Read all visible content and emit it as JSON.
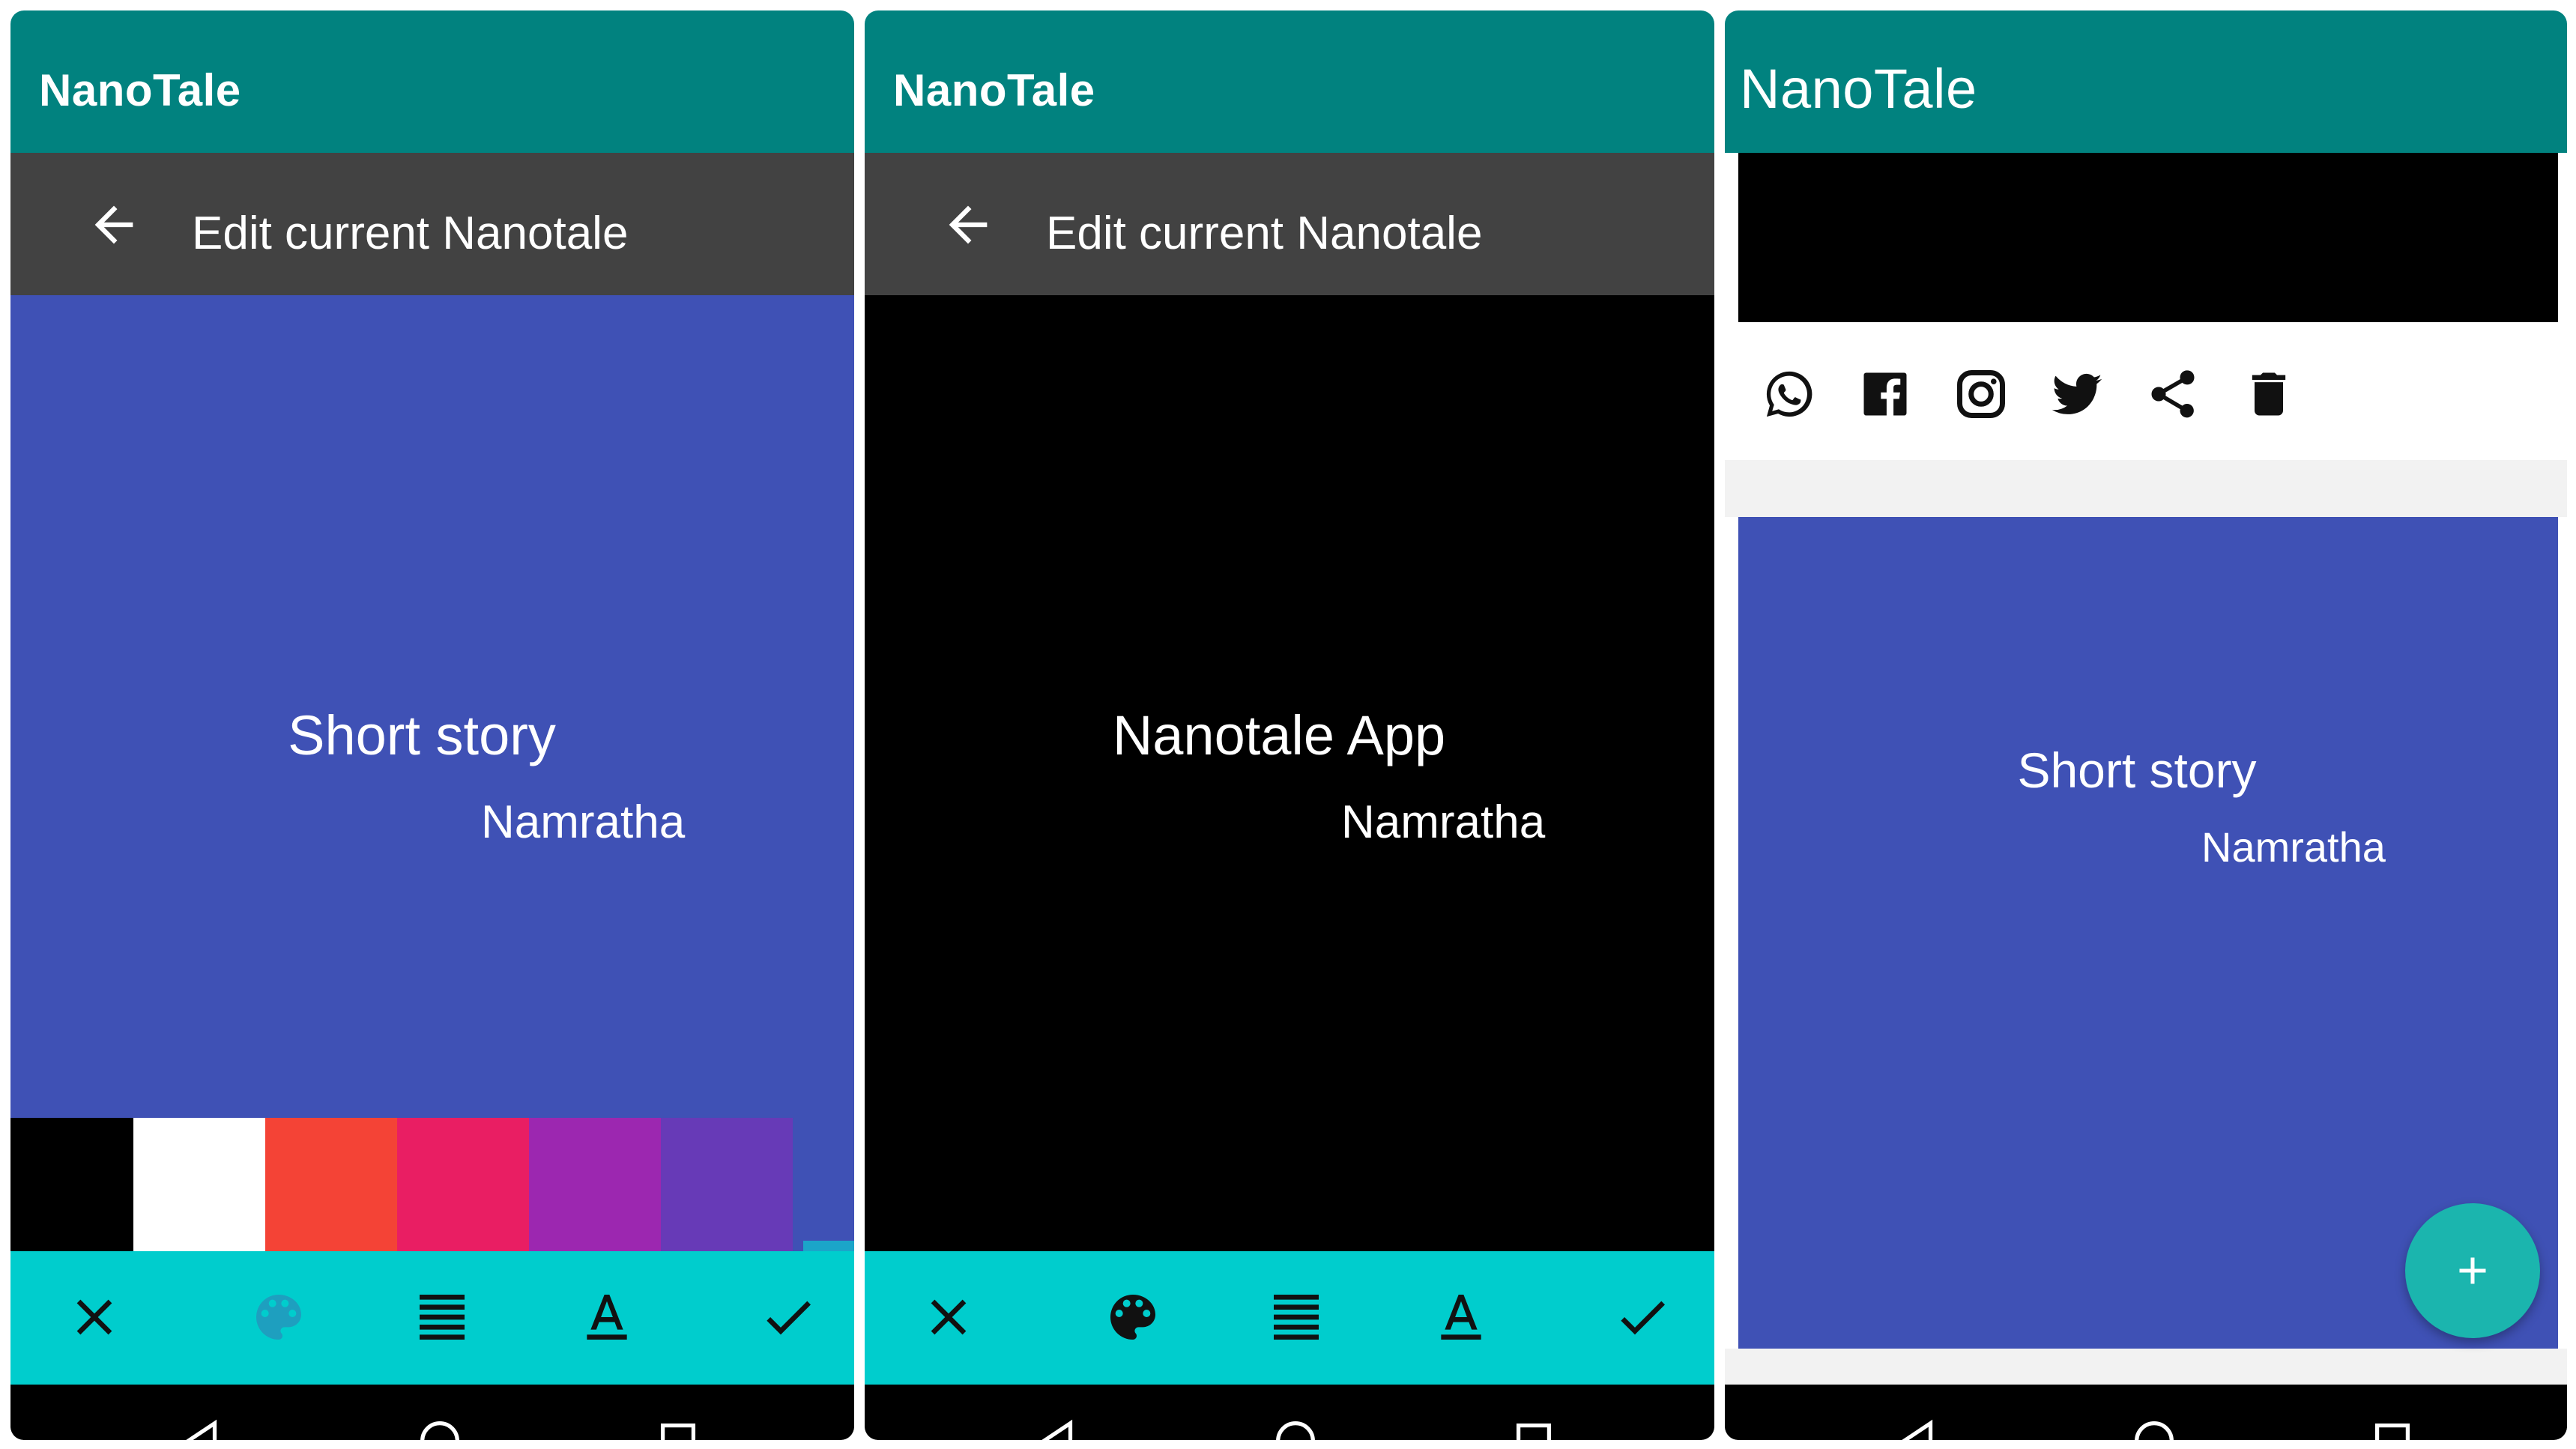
{
  "panels": [
    {
      "app_title": "NanoTale",
      "edit_title": "Edit current Nanotale",
      "story_title": "Short story",
      "story_author": "Namratha",
      "background_color": "#3f51b5",
      "swatch_colors": [
        "#000000",
        "#ffffff",
        "#f44336",
        "#e91e63",
        "#9c27b0",
        "#673ab7"
      ],
      "toolbar": [
        "close-icon",
        "palette-icon",
        "align-icon",
        "text-color-icon",
        "check-icon"
      ]
    },
    {
      "app_title": "NanoTale",
      "edit_title": "Edit current Nanotale",
      "story_title": "Nanotale App",
      "story_author": "Namratha",
      "background_color": "#000000",
      "toolbar": [
        "close-icon",
        "palette-icon",
        "align-icon",
        "text-color-icon",
        "check-icon"
      ]
    },
    {
      "app_title": "NanoTale",
      "share_icons": [
        "whatsapp-icon",
        "facebook-icon",
        "instagram-icon",
        "twitter-icon",
        "share-icon",
        "delete-icon"
      ],
      "story_title": "Short story",
      "story_author": "Namratha",
      "card_color": "#3f51b5",
      "fab": "add-icon"
    }
  ],
  "colors": {
    "appbar": "#01827f",
    "editbar": "#424242",
    "toolbar": "#00cdcd",
    "fab": "#1bb5ae"
  },
  "navigation": [
    "back-nav-icon",
    "home-nav-icon",
    "recents-nav-icon"
  ]
}
